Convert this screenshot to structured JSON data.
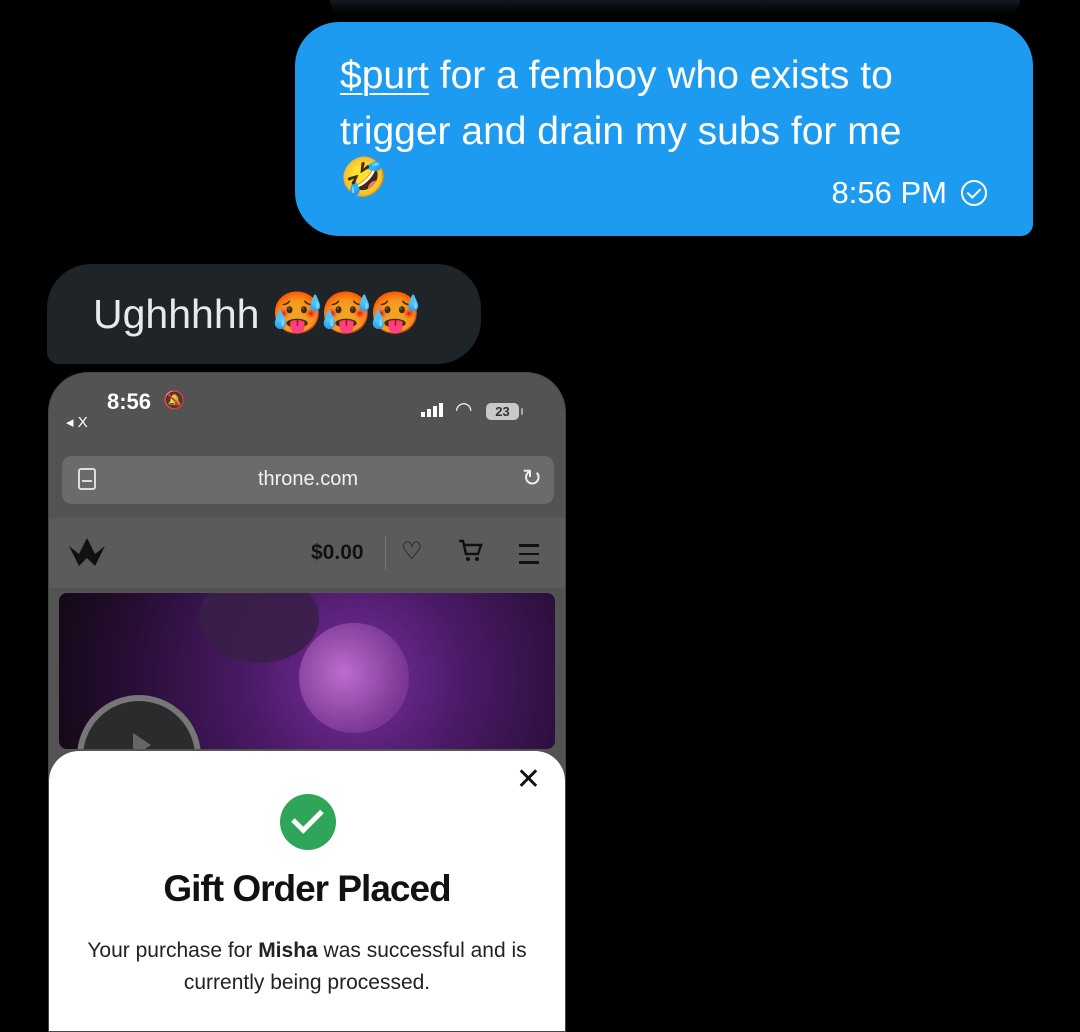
{
  "messages": {
    "outgoing": {
      "cashtag": "$purt",
      "text": " for a femboy who exists to trigger and drain my subs for me",
      "emoji": "🤣",
      "time": "8:56 PM",
      "status_icon": "check-circle-icon"
    },
    "incoming": {
      "text": "Ughhhhh",
      "emojis": "🥵🥵🥵"
    }
  },
  "screenshot": {
    "status_bar": {
      "time": "8:56",
      "back_label": "◂ X",
      "battery": "23"
    },
    "browser": {
      "url": "throne.com"
    },
    "site": {
      "balance": "$0.00"
    },
    "modal": {
      "title": "Gift Order Placed",
      "desc_prefix": "Your purchase for ",
      "recipient": "Misha",
      "desc_suffix": " was successful and is currently being processed."
    }
  }
}
